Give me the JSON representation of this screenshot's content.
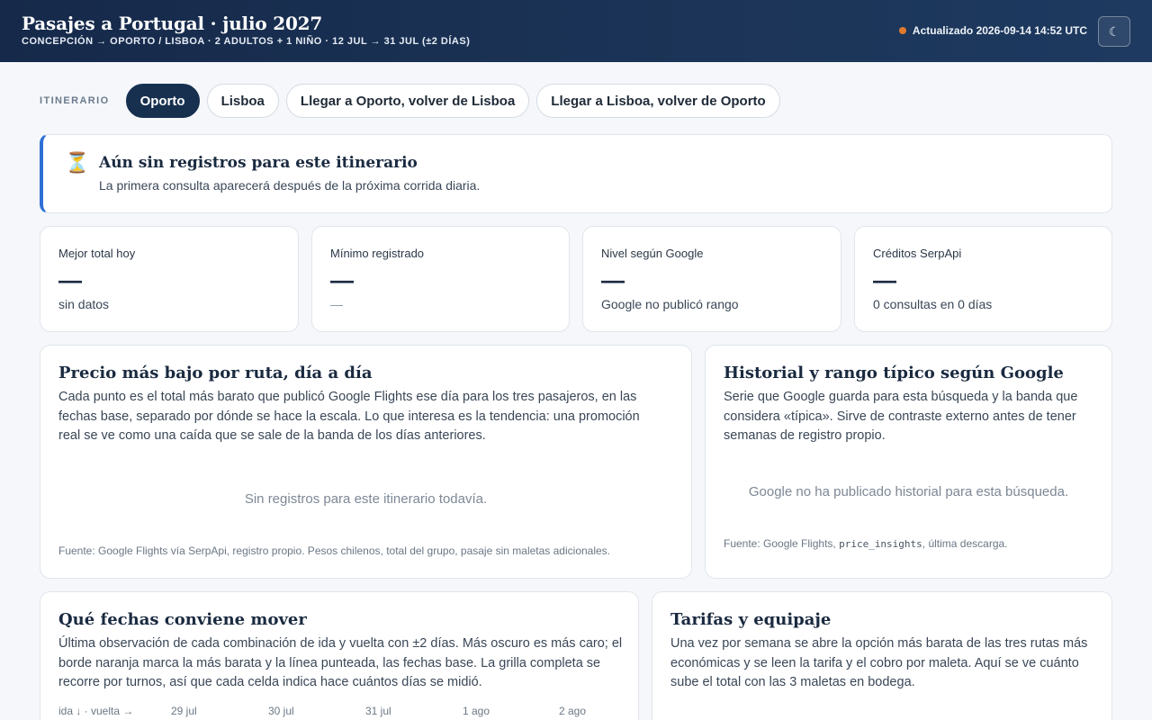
{
  "header": {
    "title": "Pasajes a Portugal · julio 2027",
    "subtitle": "CONCEPCIÓN → OPORTO / LISBOA · 2 ADULTOS + 1 NIÑO · 12 JUL → 31 JUL (±2 DÍAS)",
    "updated": "Actualizado 2026-09-14 14:52 UTC",
    "status_color": "#e07b2e",
    "theme_toggle_icon": "☾"
  },
  "itinerary": {
    "label": "ITINERARIO",
    "tabs": [
      {
        "label": "Oporto",
        "active": true
      },
      {
        "label": "Lisboa",
        "active": false
      },
      {
        "label": "Llegar a Oporto, volver de Lisboa",
        "active": false
      },
      {
        "label": "Llegar a Lisboa, volver de Oporto",
        "active": false
      }
    ]
  },
  "notice": {
    "icon": "⏳",
    "title": "Aún sin registros para este itinerario",
    "body": "La primera consulta aparecerá después de la próxima corrida diaria.",
    "accent": "#2f6fd6"
  },
  "stats": [
    {
      "label": "Mejor total hoy",
      "value": "—",
      "note": "sin datos"
    },
    {
      "label": "Mínimo registrado",
      "value": "—",
      "note": "—"
    },
    {
      "label": "Nivel según Google",
      "value": "—",
      "note": "Google no publicó rango"
    },
    {
      "label": "Créditos SerpApi",
      "value": "—",
      "note": "0 consultas en 0 días"
    }
  ],
  "panels": {
    "route_prices": {
      "title": "Precio más bajo por ruta, día a día",
      "description": "Cada punto es el total más barato que publicó Google Flights ese día para los tres pasajeros, en las fechas base, separado por dónde se hace la escala. Lo que interesa es la tendencia: una promoción real se ve como una caída que se sale de la banda de los días anteriores.",
      "empty": "Sin registros para este itinerario todavía.",
      "source": "Fuente: Google Flights vía SerpApi, registro propio. Pesos chilenos, total del grupo, pasaje sin maletas adicionales."
    },
    "history": {
      "title": "Historial y rango típico según Google",
      "description": "Serie que Google guarda para esta búsqueda y la banda que considera «típica». Sirve de contraste externo antes de tener semanas de registro propio.",
      "empty": "Google no ha publicado historial para esta búsqueda.",
      "source_prefix": "Fuente: Google Flights, ",
      "source_code": "price_insights",
      "source_suffix": ", última descarga."
    },
    "dates": {
      "title": "Qué fechas conviene mover",
      "description": "Última observación de cada combinación de ida y vuelta con ±2 días. Más oscuro es más caro; el borde naranja marca la más barata y la línea punteada, las fechas base. La grilla completa se recorre por turnos, así que cada celda indica hace cuántos días se midió.",
      "axis_label": "ida ↓ · vuelta →",
      "columns": [
        "29 jul",
        "30 jul",
        "31 jul",
        "1 ago",
        "2 ago"
      ]
    },
    "fares": {
      "title": "Tarifas y equipaje",
      "description": "Una vez por semana se abre la opción más barata de las tres rutas más económicas y se leen la tarifa y el cobro por maleta. Aquí se ve cuánto sube el total con las 3 maletas en bodega."
    }
  }
}
